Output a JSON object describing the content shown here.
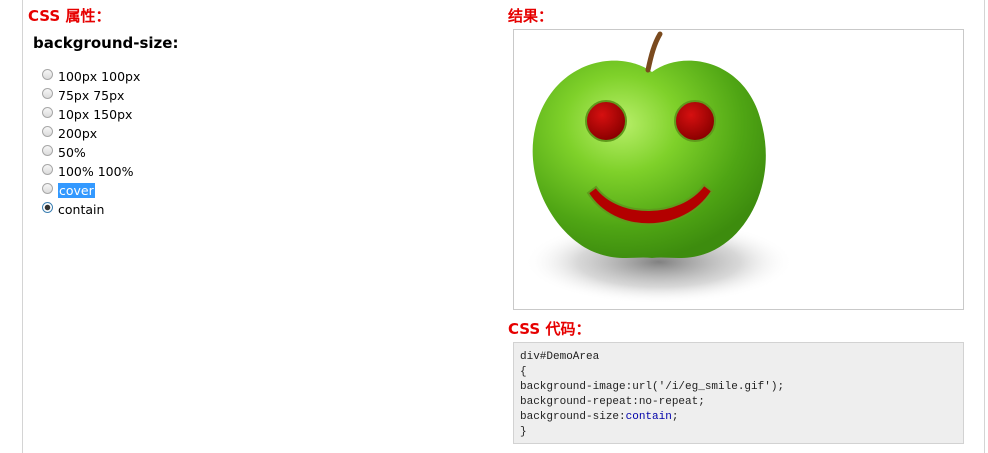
{
  "css_title": "CSS 属性：",
  "property_name": "background-size:",
  "options": [
    {
      "label": "100px 100px",
      "checked": false,
      "highlighted": false
    },
    {
      "label": "75px 75px",
      "checked": false,
      "highlighted": false
    },
    {
      "label": "10px 150px",
      "checked": false,
      "highlighted": false
    },
    {
      "label": "200px",
      "checked": false,
      "highlighted": false
    },
    {
      "label": "50%",
      "checked": false,
      "highlighted": false
    },
    {
      "label": "100% 100%",
      "checked": false,
      "highlighted": false
    },
    {
      "label": "cover",
      "checked": false,
      "highlighted": true
    },
    {
      "label": "contain",
      "checked": true,
      "highlighted": false
    }
  ],
  "result_title": "结果：",
  "result_image": "green-apple-smiley-face",
  "code_title": "CSS 代码：",
  "code": {
    "line1": "div#DemoArea",
    "line2": "{",
    "line3": "background-image:url('/i/eg_smile.gif');",
    "line4": "background-repeat:no-repeat;",
    "line5_prefix": "background-size:",
    "line5_value": "contain",
    "line5_suffix": ";",
    "line6": "}"
  },
  "colors": {
    "title_red": "#e60000",
    "apple_green": "#6cc21f",
    "eye_red": "#b30000",
    "code_value_blue": "#0000aa",
    "highlight_blue": "#3399ff"
  }
}
